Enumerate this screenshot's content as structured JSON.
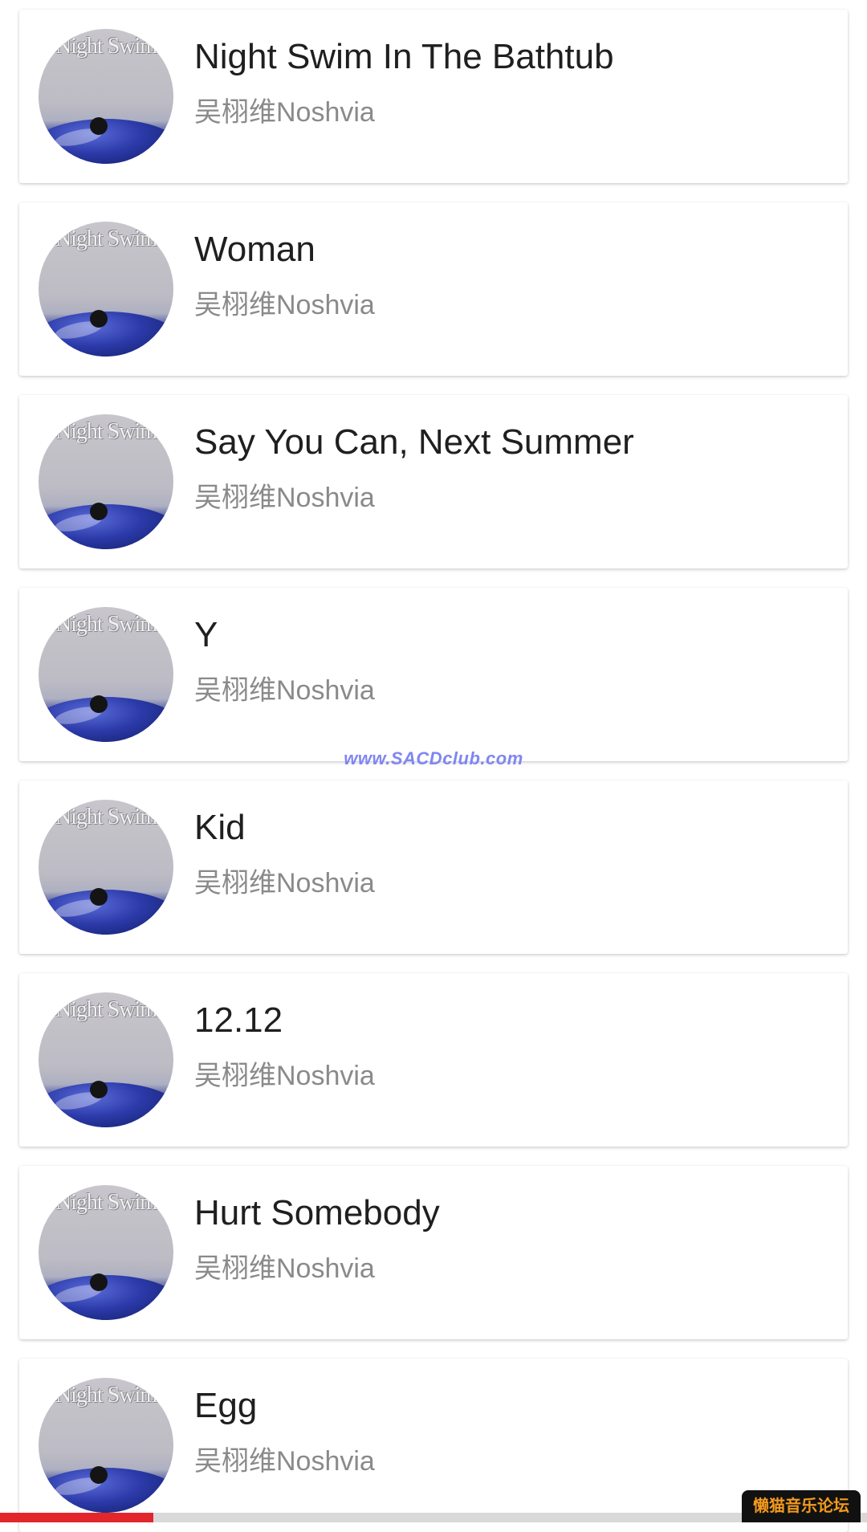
{
  "tracks": [
    {
      "title": "Night Swim In The Bathtub",
      "artist": "吴栩维Noshvia"
    },
    {
      "title": "Woman",
      "artist": "吴栩维Noshvia"
    },
    {
      "title": "Say You Can, Next Summer",
      "artist": "吴栩维Noshvia"
    },
    {
      "title": "Y",
      "artist": "吴栩维Noshvia"
    },
    {
      "title": "Kid",
      "artist": "吴栩维Noshvia"
    },
    {
      "title": "12.12",
      "artist": "吴栩维Noshvia"
    },
    {
      "title": "Hurt Somebody",
      "artist": "吴栩维Noshvia"
    },
    {
      "title": "Egg",
      "artist": "吴栩维Noshvia"
    }
  ],
  "album_art_text": "Night Swim",
  "watermark": "www.SACDclub.com",
  "forum_badge": "懒猫音乐论坛",
  "playback_progress": 0.177,
  "colors": {
    "progress": "#e2262c",
    "title": "#1f1f1f",
    "artist": "#8a8a8a",
    "watermark": "#7f86f2"
  }
}
